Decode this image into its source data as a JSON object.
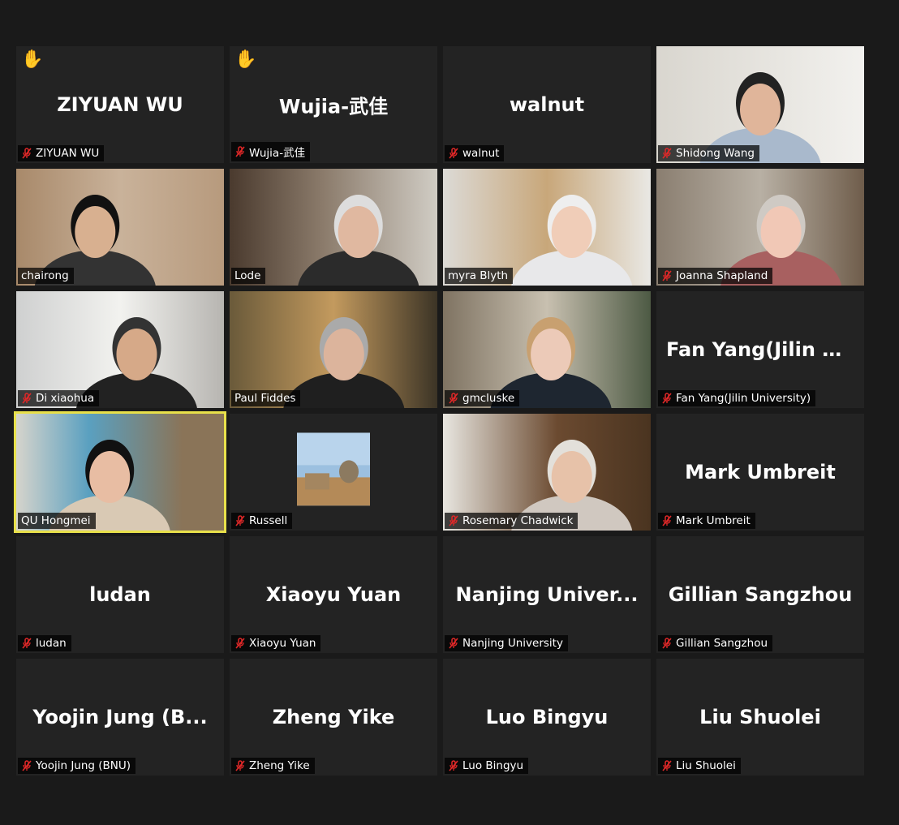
{
  "participants": [
    {
      "display": "ZIYUAN WU",
      "label": "ZIYUAN WU",
      "muted": true,
      "hand": true
    },
    {
      "display": "Wujia-武佳",
      "label": "Wujia-武佳",
      "muted": true,
      "hand": true
    },
    {
      "display": "walnut",
      "label": "walnut",
      "muted": true
    },
    {
      "label": "Shidong Wang",
      "muted": true,
      "video": true
    },
    {
      "label": "chairong",
      "muted": false,
      "video": true
    },
    {
      "label": "Lode",
      "muted": false,
      "video": true
    },
    {
      "label": "myra Blyth",
      "muted": false,
      "video": true
    },
    {
      "label": "Joanna Shapland",
      "muted": true,
      "video": true
    },
    {
      "label": "Di xiaohua",
      "muted": true,
      "video": true
    },
    {
      "label": "Paul Fiddes",
      "muted": false,
      "video": true
    },
    {
      "label": "gmcluske",
      "muted": true,
      "video": true
    },
    {
      "display": "Fan Yang(Jilin U...",
      "label": "Fan Yang(Jilin University)",
      "muted": true
    },
    {
      "label": "QU Hongmei",
      "muted": false,
      "video": true,
      "active": true
    },
    {
      "label": "Russell",
      "muted": true,
      "picture": true
    },
    {
      "label": "Rosemary Chadwick",
      "muted": true,
      "video": true
    },
    {
      "display": "Mark Umbreit",
      "label": "Mark Umbreit",
      "muted": true
    },
    {
      "display": "ludan",
      "label": "ludan",
      "muted": true
    },
    {
      "display": "Xiaoyu Yuan",
      "label": "Xiaoyu Yuan",
      "muted": true
    },
    {
      "display": "Nanjing  Univer...",
      "label": "Nanjing University",
      "muted": true
    },
    {
      "display": "Gillian Sangzhou",
      "label": "Gillian Sangzhou",
      "muted": true
    },
    {
      "display": "Yoojin Jung (B...",
      "label": "Yoojin Jung (BNU)",
      "muted": true
    },
    {
      "display": "Zheng Yike",
      "label": "Zheng Yike",
      "muted": true
    },
    {
      "display": "Luo Bingyu",
      "label": "Luo Bingyu",
      "muted": true
    },
    {
      "display": "Liu Shuolei",
      "label": "Liu Shuolei",
      "muted": true
    }
  ],
  "icons": {
    "raised_hand": "raised-hand-icon",
    "muted": "mic-muted-icon"
  },
  "colors": {
    "background": "#1a1a1a",
    "tile": "#232323",
    "active_speaker": "#e8e04a",
    "mute_red": "#e02828"
  }
}
